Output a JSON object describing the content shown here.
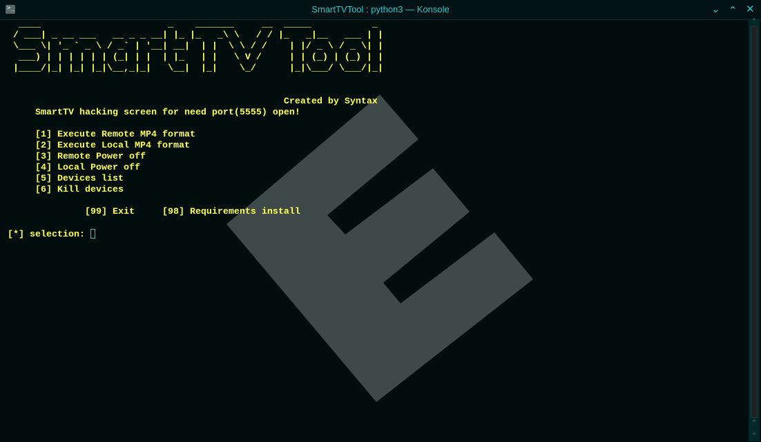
{
  "window": {
    "title": "SmartTVTool : python3 — Konsole",
    "icon": "terminal-icon",
    "buttons": [
      "minimize",
      "maximize",
      "close"
    ]
  },
  "terminal": {
    "banner": [
      "  ____                       _    _______     __  _____           _ ",
      " / ___| _ __ ___   __ _ _ __| |_ |_   _\\ \\   / / |_   _|__   ___ | |",
      " \\___ \\| '_ ` _ \\ / _` | '__| __|  | |  \\ \\ / /    | |/ _ \\ / _ \\| |",
      "  ___) | | | | | | (_| | |  | |_   | |   \\ V /     | | (_) | (_) | |",
      " |____/|_| |_| |_|\\__,_|_|   \\__|  |_|    \\_/      |_|\\___/ \\___/|_|"
    ],
    "credit": "                                                  Created by Syntax",
    "subtitle": "     SmartTV hacking screen for need port(5555) open!",
    "menu": [
      "     [1] Execute Remote MP4 format",
      "     [2] Execute Local MP4 format",
      "     [3] Remote Power off",
      "     [4] Local Power off",
      "     [5] Devices list",
      "     [6] Kill devices"
    ],
    "extra": "              [99] Exit     [98] Requirements install",
    "prompt": "[*] selection: "
  },
  "colors": {
    "text": "#ffff55",
    "accent": "#1fc9c9",
    "watermark": "#3e4a4a",
    "background": "#020d0e"
  }
}
